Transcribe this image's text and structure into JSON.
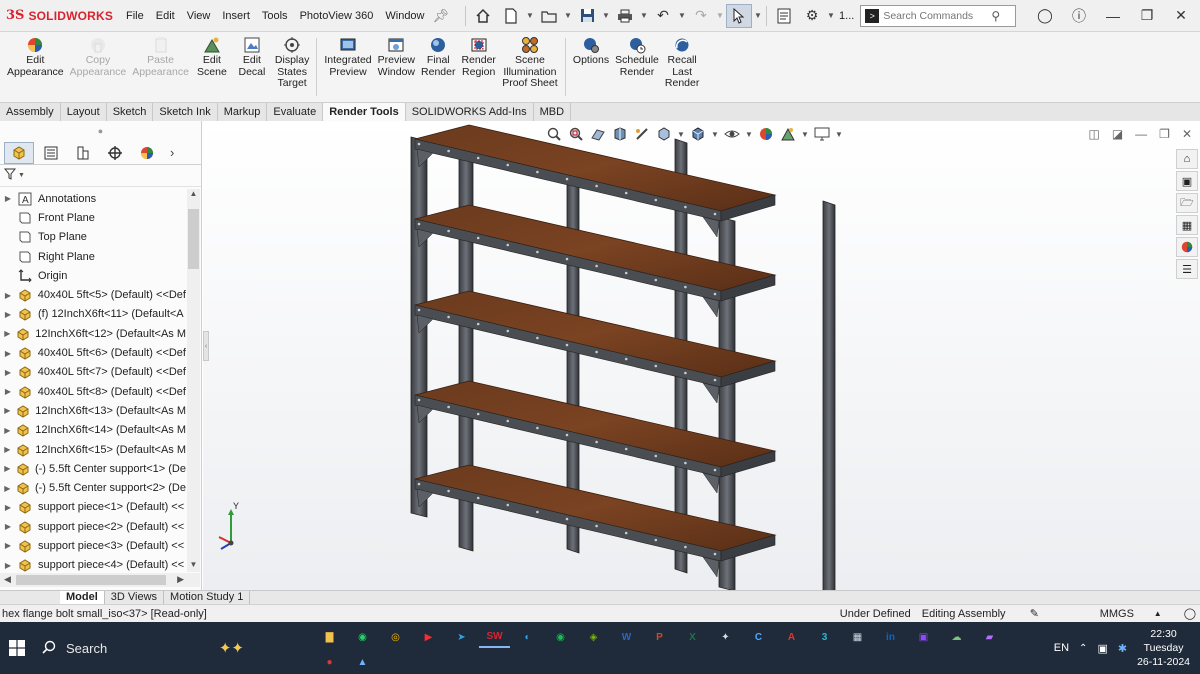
{
  "app": {
    "logo_ds": "3S",
    "logo_name": "SOLIDWORKS"
  },
  "menu": [
    "File",
    "Edit",
    "View",
    "Insert",
    "Tools",
    "PhotoView 360",
    "Window"
  ],
  "quick_access": {
    "more_label": "1..."
  },
  "search": {
    "placeholder": "Search Commands"
  },
  "ribbon": [
    {
      "label": "Edit\nAppearance",
      "icon": "appearance-icon",
      "disabled": false
    },
    {
      "label": "Copy\nAppearance",
      "icon": "copy-appearance-icon",
      "disabled": true
    },
    {
      "label": "Paste\nAppearance",
      "icon": "paste-appearance-icon",
      "disabled": true
    },
    {
      "label": "Edit\nScene",
      "icon": "scene-icon",
      "disabled": false
    },
    {
      "label": "Edit\nDecal",
      "icon": "decal-icon",
      "disabled": false
    },
    {
      "label": "Display\nStates\nTarget",
      "icon": "display-states-icon",
      "disabled": false
    },
    {
      "label": "Integrated\nPreview",
      "icon": "integrated-preview-icon",
      "disabled": false
    },
    {
      "label": "Preview\nWindow",
      "icon": "preview-window-icon",
      "disabled": false
    },
    {
      "label": "Final\nRender",
      "icon": "final-render-icon",
      "disabled": false
    },
    {
      "label": "Render\nRegion",
      "icon": "render-region-icon",
      "disabled": false
    },
    {
      "label": "Scene\nIllumination\nProof Sheet",
      "icon": "proof-sheet-icon",
      "disabled": false
    },
    {
      "label": "Options",
      "icon": "options-icon",
      "disabled": false
    },
    {
      "label": "Schedule\nRender",
      "icon": "schedule-render-icon",
      "disabled": false
    },
    {
      "label": "Recall\nLast\nRender",
      "icon": "recall-render-icon",
      "disabled": false
    }
  ],
  "command_tabs": [
    "Assembly",
    "Layout",
    "Sketch",
    "Sketch Ink",
    "Markup",
    "Evaluate",
    "Render Tools",
    "SOLIDWORKS Add-Ins",
    "MBD"
  ],
  "active_command_tab": "Render Tools",
  "tree": [
    {
      "label": "Annotations",
      "icon": "annotations-icon",
      "expand": true
    },
    {
      "label": "Front Plane",
      "icon": "plane-icon",
      "expand": false
    },
    {
      "label": "Top Plane",
      "icon": "plane-icon",
      "expand": false
    },
    {
      "label": "Right Plane",
      "icon": "plane-icon",
      "expand": false
    },
    {
      "label": "Origin",
      "icon": "origin-icon",
      "expand": false
    },
    {
      "label": "40x40L 5ft<5> (Default) <<Def",
      "icon": "part-icon",
      "expand": true
    },
    {
      "label": "(f) 12InchX6ft<11> (Default<A",
      "icon": "part-icon",
      "expand": true
    },
    {
      "label": "12InchX6ft<12> (Default<As M",
      "icon": "part-icon",
      "expand": true
    },
    {
      "label": "40x40L 5ft<6> (Default) <<Def",
      "icon": "part-icon",
      "expand": true
    },
    {
      "label": "40x40L 5ft<7> (Default) <<Def",
      "icon": "part-icon",
      "expand": true
    },
    {
      "label": "40x40L 5ft<8> (Default) <<Def",
      "icon": "part-icon",
      "expand": true
    },
    {
      "label": "12InchX6ft<13> (Default<As M",
      "icon": "part-icon",
      "expand": true
    },
    {
      "label": "12InchX6ft<14> (Default<As M",
      "icon": "part-icon",
      "expand": true
    },
    {
      "label": "12InchX6ft<15> (Default<As M",
      "icon": "part-icon",
      "expand": true
    },
    {
      "label": "(-) 5.5ft Center support<1> (De",
      "icon": "part-icon",
      "expand": true
    },
    {
      "label": "(-) 5.5ft Center support<2> (De",
      "icon": "part-icon",
      "expand": true
    },
    {
      "label": "support piece<1> (Default) <<",
      "icon": "part-icon",
      "expand": true
    },
    {
      "label": "support piece<2> (Default) <<",
      "icon": "part-icon",
      "expand": true
    },
    {
      "label": "support piece<3> (Default) <<",
      "icon": "part-icon",
      "expand": true
    },
    {
      "label": "support piece<4> (Default) <<",
      "icon": "part-icon",
      "expand": true
    }
  ],
  "bottom_tabs": [
    "Model",
    "3D Views",
    "Motion Study 1"
  ],
  "active_bottom_tab": "Model",
  "status": {
    "left": "hex flange bolt small_iso<37> [Read-only]",
    "state": "Under Defined",
    "mode": "Editing Assembly",
    "units": "MMGS"
  },
  "triad": {
    "y_label": "Y"
  },
  "taskbar": {
    "search_label": "Search",
    "apps": [
      {
        "name": "file-explorer-icon",
        "glyph": "▇",
        "color": "#f2c14e",
        "open": false
      },
      {
        "name": "whatsapp-icon",
        "glyph": "◉",
        "color": "#25d366",
        "open": false
      },
      {
        "name": "chrome-icon",
        "glyph": "◎",
        "color": "#fbbc05",
        "open": false
      },
      {
        "name": "youtube-icon",
        "glyph": "▶",
        "color": "#ff2b2b",
        "open": false
      },
      {
        "name": "telegram-icon",
        "glyph": "➤",
        "color": "#2aa3e0",
        "open": false
      },
      {
        "name": "solidworks-taskbar-icon",
        "glyph": "SW",
        "color": "#d9232f",
        "open": true
      },
      {
        "name": "edge-icon",
        "glyph": "◐",
        "color": "#2fa4ea",
        "open": false
      },
      {
        "name": "spotify-icon",
        "glyph": "◉",
        "color": "#1db954",
        "open": false
      },
      {
        "name": "nvidia-icon",
        "glyph": "◈",
        "color": "#76b900",
        "open": false
      },
      {
        "name": "word-icon",
        "glyph": "W",
        "color": "#2b65c5",
        "open": false
      },
      {
        "name": "powerpoint-icon",
        "glyph": "P",
        "color": "#d24726",
        "open": false
      },
      {
        "name": "excel-icon",
        "glyph": "X",
        "color": "#1e7145",
        "open": false
      },
      {
        "name": "inkscape-icon",
        "glyph": "✦",
        "color": "#dddddd",
        "open": false
      },
      {
        "name": "copilot-icon",
        "glyph": "C",
        "color": "#4aa8ff",
        "open": false
      },
      {
        "name": "acrobat-icon",
        "glyph": "A",
        "color": "#e2332a",
        "open": false
      },
      {
        "name": "app-3-icon",
        "glyph": "3",
        "color": "#2fb5c9",
        "open": false
      },
      {
        "name": "tiles-icon",
        "glyph": "▦",
        "color": "#cfd8e3",
        "open": false
      },
      {
        "name": "linkedin-icon",
        "glyph": "in",
        "color": "#0a66c2",
        "open": false
      },
      {
        "name": "twitch-icon",
        "glyph": "▣",
        "color": "#9146ff",
        "open": false
      },
      {
        "name": "cloud-icon",
        "glyph": "☁",
        "color": "#7cc47c",
        "open": false
      },
      {
        "name": "video-icon",
        "glyph": "▰",
        "color": "#b36cff",
        "open": false
      },
      {
        "name": "record-icon",
        "glyph": "●",
        "color": "#e33333",
        "open": false
      },
      {
        "name": "photos-icon",
        "glyph": "▲",
        "color": "#6fb3ff",
        "open": false
      }
    ],
    "language": "EN",
    "time": "22:30",
    "day": "Tuesday",
    "date": "26-11-2024"
  }
}
